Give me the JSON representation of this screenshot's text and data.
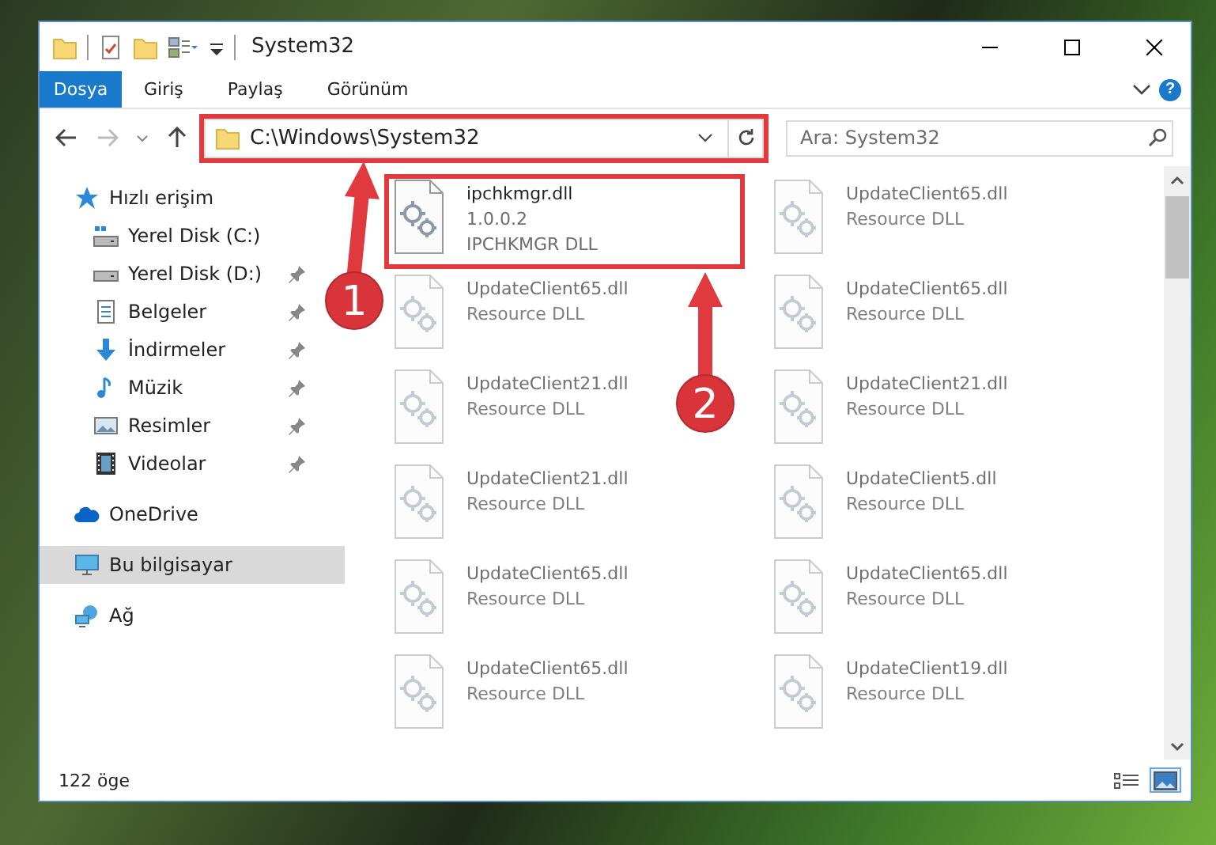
{
  "window": {
    "title": "System32"
  },
  "ribbon": {
    "tabs": [
      {
        "label": "Dosya",
        "kind": "file"
      },
      {
        "label": "Giriş",
        "kind": "tab"
      },
      {
        "label": "Paylaş",
        "kind": "tab"
      },
      {
        "label": "Görünüm",
        "kind": "tab"
      }
    ],
    "help": "?"
  },
  "address_bar": {
    "path": "C:\\Windows\\System32",
    "highlighted": true
  },
  "search": {
    "placeholder": "Ara: System32"
  },
  "sidebar": {
    "items": [
      {
        "label": "Hızlı erişim",
        "kind": "quick",
        "selected": false,
        "children": [
          {
            "label": "Yerel Disk (C:)",
            "kind": "windrive",
            "selected": false,
            "pinned": false
          },
          {
            "label": "Yerel Disk (D:)",
            "kind": "drive",
            "selected": false,
            "pinned": true
          },
          {
            "label": "Belgeler",
            "kind": "docs",
            "selected": false,
            "pinned": true
          },
          {
            "label": "İndirmeler",
            "kind": "download",
            "selected": false,
            "pinned": true
          },
          {
            "label": "Müzik",
            "kind": "music",
            "selected": false,
            "pinned": true
          },
          {
            "label": "Resimler",
            "kind": "pictures",
            "selected": false,
            "pinned": true
          },
          {
            "label": "Videolar",
            "kind": "videos",
            "selected": false,
            "pinned": true
          }
        ]
      },
      {
        "label": "OneDrive",
        "kind": "cloud",
        "selected": false
      },
      {
        "label": "Bu bilgisayar",
        "kind": "pc",
        "selected": true
      },
      {
        "label": "Ağ",
        "kind": "network",
        "selected": false
      }
    ]
  },
  "files": [
    {
      "name": "ipchkmgr.dll",
      "details": [
        "1.0.0.2",
        "IPCHKMGR DLL"
      ],
      "blurred": false,
      "highlighted": true
    },
    {
      "name": "UpdateClient65.dll",
      "details": [
        "Resource DLL"
      ],
      "blurred": true,
      "highlighted": false
    },
    {
      "name": "UpdateClient65.dll",
      "details": [
        "Resource DLL"
      ],
      "blurred": true,
      "highlighted": false
    },
    {
      "name": "UpdateClient65.dll",
      "details": [
        "Resource DLL"
      ],
      "blurred": true,
      "highlighted": false
    },
    {
      "name": "UpdateClient21.dll",
      "details": [
        "Resource DLL"
      ],
      "blurred": true,
      "highlighted": false
    },
    {
      "name": "UpdateClient21.dll",
      "details": [
        "Resource DLL"
      ],
      "blurred": true,
      "highlighted": false
    },
    {
      "name": "UpdateClient21.dll",
      "details": [
        "Resource DLL"
      ],
      "blurred": true,
      "highlighted": false
    },
    {
      "name": "UpdateClient5.dll",
      "details": [
        "Resource DLL"
      ],
      "blurred": true,
      "highlighted": false
    },
    {
      "name": "UpdateClient65.dll",
      "details": [
        "Resource DLL"
      ],
      "blurred": true,
      "highlighted": false
    },
    {
      "name": "UpdateClient65.dll",
      "details": [
        "Resource DLL"
      ],
      "blurred": true,
      "highlighted": false
    },
    {
      "name": "UpdateClient65.dll",
      "details": [
        "Resource DLL"
      ],
      "blurred": true,
      "highlighted": false
    },
    {
      "name": "UpdateClient19.dll",
      "details": [
        "Resource DLL"
      ],
      "blurred": true,
      "highlighted": false
    }
  ],
  "status_bar": {
    "count": "122 öge",
    "views": [
      {
        "kind": "details",
        "selected": false
      },
      {
        "kind": "large",
        "selected": true
      }
    ]
  },
  "annotations": [
    {
      "label": "1"
    },
    {
      "label": "2"
    }
  ]
}
